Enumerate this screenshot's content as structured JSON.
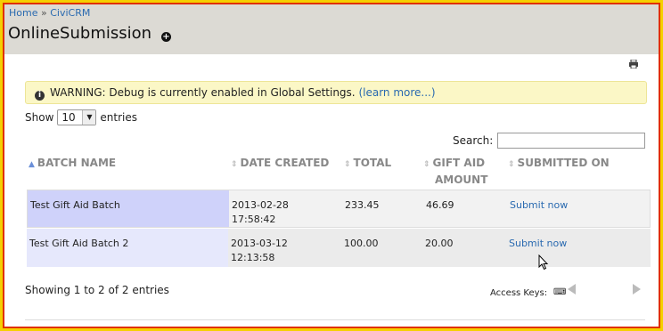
{
  "breadcrumb": {
    "home": "Home",
    "sep": "»",
    "civicrm": "CiviCRM"
  },
  "page_title": "OnlineSubmission",
  "warning": {
    "text": "WARNING: Debug is currently enabled in Global Settings.",
    "link": "(learn more...)"
  },
  "length": {
    "show": "Show",
    "value": "10",
    "entries": "entries"
  },
  "search": {
    "label": "Search:",
    "value": ""
  },
  "columns": {
    "batch_name": "BATCH NAME",
    "date_created": "DATE CREATED",
    "total": "TOTAL",
    "gift_aid_1": "GIFT AID",
    "gift_aid_2": "AMOUNT",
    "submitted_on": "SUBMITTED ON"
  },
  "rows": [
    {
      "name": "Test Gift Aid Batch",
      "date": "2013-02-28",
      "time": "17:58:42",
      "total": "233.45",
      "gift_aid": "46.69",
      "action": "Submit now"
    },
    {
      "name": "Test Gift Aid Batch 2",
      "date": "2013-03-12",
      "time": "12:13:58",
      "total": "100.00",
      "gift_aid": "20.00",
      "action": "Submit now"
    }
  ],
  "info": "Showing 1 to 2 of 2 entries",
  "access_keys": "Access Keys:",
  "icons": {
    "plus": "plus-circle-icon",
    "print": "print-icon",
    "info": "info-icon",
    "keyboard": "keyboard-icon",
    "prev": "previous-arrow-icon",
    "next": "next-arrow-icon",
    "cursor": "mouse-cursor-icon"
  }
}
